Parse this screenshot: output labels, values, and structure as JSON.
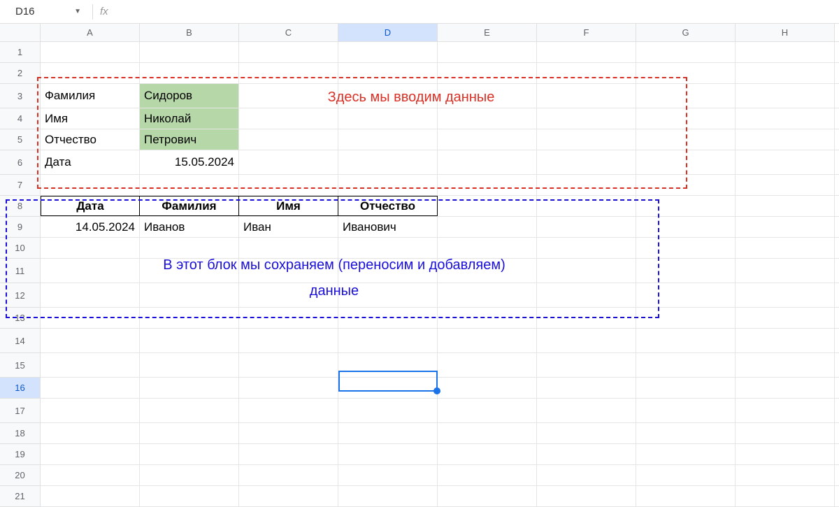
{
  "nameBox": "D16",
  "fxLabel": "fx",
  "formula": "",
  "columns": [
    "A",
    "B",
    "C",
    "D",
    "E",
    "F",
    "G",
    "H"
  ],
  "selectedColumn": "D",
  "rows": [
    "1",
    "2",
    "3",
    "4",
    "5",
    "6",
    "7",
    "8",
    "9",
    "10",
    "11",
    "12",
    "13",
    "14",
    "15",
    "16",
    "17",
    "18",
    "19",
    "20",
    "21"
  ],
  "selectedRow": "16",
  "entry": {
    "labels": {
      "surname": "Фамилия",
      "name": "Имя",
      "patronymic": "Отчество",
      "date": "Дата"
    },
    "values": {
      "surname": "Сидоров",
      "name": "Николай",
      "patronymic": "Петрович",
      "date": "15.05.2024"
    }
  },
  "table": {
    "headers": {
      "date": "Дата",
      "surname": "Фамилия",
      "name": "Имя",
      "patronymic": "Отчество"
    },
    "row1": {
      "date": "14.05.2024",
      "surname": "Иванов",
      "name": "Иван",
      "patronymic": "Иванович"
    }
  },
  "annotations": {
    "red": "Здесь мы вводим данные",
    "blueLine1": "В этот блок мы сохраняем (переносим и добавляем)",
    "blueLine2": "данные"
  }
}
